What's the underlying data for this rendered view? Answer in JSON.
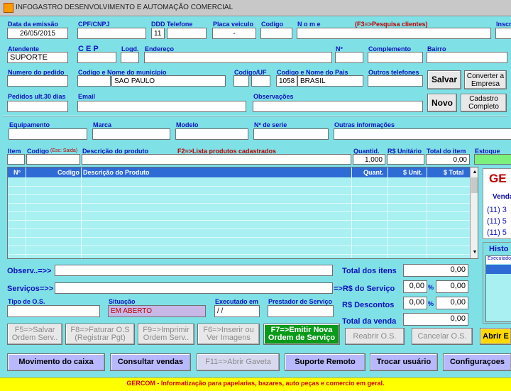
{
  "window": {
    "title": "INFOGASTRO DESENVOLVIMENTO E AUTOMAÇÃO COMERCIAL"
  },
  "header": {
    "data_emissao_label": "Data da emissão",
    "data_emissao": "26/05/2015",
    "cpf_label": "CPF/CNPJ",
    "ddd_label": "DDD",
    "ddd": "11",
    "telefone_label": "Telefone",
    "placa_label": "Placa veiculo",
    "placa": "-",
    "codigo_label": "Codigo",
    "nome_label": "N o m e",
    "nome_hint": "(F3=>Pesquisa clientes)",
    "inscr_label": "Inscr",
    "atendente_label": "Atendente",
    "atendente": "SUPORTE",
    "cep_label": "C E P",
    "logd_label": "Logd.",
    "endereco_label": "Endereço",
    "numero_label": "Nº",
    "complemento_label": "Complemento",
    "bairro_label": "Bairro",
    "pedido_label": "Numero do pedido",
    "municipio_label": "Codigo  e Nome do municipio",
    "municipio": "SAO PAULO",
    "uf_label": "Codigo/UF",
    "pais_label": "Codigo e Nome do Pais",
    "pais_codigo": "1058",
    "pais": "BRASIL",
    "outros_tel_label": "Outros telefones",
    "pedidos30_label": "Pedidos ult.30 dias",
    "email_label": "Email",
    "obs_label": "Observações"
  },
  "buttons_top": {
    "salvar": "Salvar",
    "converter": "Converter a Empresa",
    "novo": "Novo",
    "cadastro": "Cadastro Completo"
  },
  "equipment": {
    "equipamento_label": "Equipamento",
    "marca_label": "Marca",
    "modelo_label": "Modelo",
    "serie_label": "Nº de serie",
    "outras_label": "Outras informações"
  },
  "item_entry": {
    "item_label": "Item",
    "codigo_label": "Codigo",
    "codigo_hint": "(Esc: Saida)",
    "descricao_label": "Descrição do produto",
    "descricao_hint": "F2=>Lista produtos cadastrados",
    "quant_label": "Quantid.",
    "quant": "1,000",
    "unit_label": "R$ Unitário",
    "total_label": "Total do item",
    "total": "0,00",
    "estoque_label": "Estoque"
  },
  "grid": {
    "columns": [
      "Nº",
      "Codigo",
      "Descrição do Produto",
      "Quant.",
      "$ Unit.",
      "$ Total"
    ],
    "rows": 9
  },
  "side_panel": {
    "title": "GE",
    "sub": "Venda",
    "phones": [
      "(11) 3",
      "(11) 5",
      "(11) 5"
    ],
    "historico_label": "Histo",
    "executado_col": "Executado"
  },
  "bottom": {
    "observ_label": "Observ..=>>",
    "servicos_label": "Serviços=>>",
    "total_itens_label": "Total  dos itens",
    "total_itens": "0,00",
    "servico_label": "=>R$  do  Serviço",
    "servico_pct": "0,00",
    "servico_val": "0,00",
    "descontos_label": "R$  Descontos",
    "desc_pct": "0,00",
    "desc_val": "0,00",
    "pct": "%",
    "total_venda_label": "Total da venda",
    "total_venda": "0,00",
    "tipo_os_label": "Tipo de O.S.",
    "situacao_label": "Situação",
    "situacao": "EM ABERTO",
    "executado_label": "Executado em",
    "executado": "/ /",
    "prestador_label": "Prestador de Serviço"
  },
  "action_buttons": {
    "f5": "F5=>Salvar Ordem Serv..",
    "f8": "F8=>Faturar O.S (Registrar Pgt)",
    "f9": "F9=>Imprimir Ordem Serv..",
    "f6": "F6=>Inserir ou Ver Imagens",
    "f7": "F7=>Emitir Nova Ordem de Serviço",
    "reabrir": "Reabrir O.S.",
    "cancelar": "Cancelar O.S.",
    "abrir": "Abrir E"
  },
  "nav_buttons": {
    "movimento": "Movimento do caixa",
    "consultar": "Consultar vendas",
    "gaveta": "F11=>Abrir Gaveta",
    "suporte": "Suporte Remoto",
    "trocar": "Trocar usuário",
    "config": "Configuraçoes"
  },
  "footer": {
    "text": "GERCOM - Informatização para papelarias, bazares, auto peças e comercio em geral."
  }
}
